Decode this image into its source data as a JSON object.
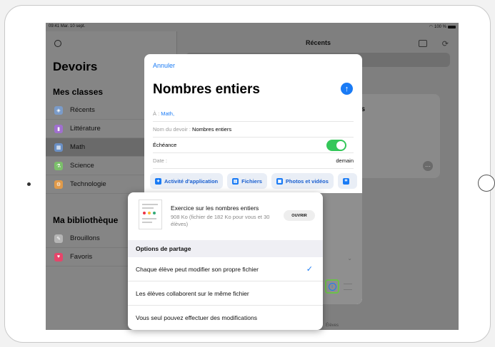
{
  "status": {
    "time": "09:41",
    "date": "Mar. 10 sept.",
    "battery": "100 %"
  },
  "sidebar": {
    "title": "Devoirs",
    "classes_header": "Mes classes",
    "classes": [
      {
        "label": "Récents",
        "color": "#7a9bc9",
        "icon": "recent-icon"
      },
      {
        "label": "Littérature",
        "color": "#a06fcf",
        "icon": "book-icon"
      },
      {
        "label": "Math",
        "color": "#6a8fc4",
        "icon": "calculator-icon"
      },
      {
        "label": "Science",
        "color": "#7bbf6a",
        "icon": "science-icon"
      },
      {
        "label": "Technologie",
        "color": "#e09a4a",
        "icon": "technology-icon"
      }
    ],
    "library_header": "Ma bibliothèque",
    "library": [
      {
        "label": "Brouillons",
        "color": "#b5b5b5",
        "icon": "draft-icon"
      },
      {
        "label": "Favoris",
        "color": "#e6456a",
        "icon": "heart-icon"
      }
    ]
  },
  "main": {
    "title": "Récents",
    "card_small": "CE",
    "card_big": "plantes",
    "card_more": "···",
    "bottom_label": "Élèves"
  },
  "sheet": {
    "cancel": "Annuler",
    "title": "Nombres entiers",
    "to_label": "À :",
    "to_value": "Math,",
    "name_label": "Nom du devoir :",
    "name_value": "Nombres entiers",
    "due_label": "Échéance",
    "date_label": "Date :",
    "date_value": "demain",
    "chips": [
      {
        "label": "Activité d'application",
        "icon": "activity-icon"
      },
      {
        "label": "Fichiers",
        "icon": "file-icon"
      },
      {
        "label": "Photos et vidéos",
        "icon": "photo-icon"
      }
    ]
  },
  "popover": {
    "file_name": "Exercice sur les nombres entiers",
    "file_meta": "908 Ko (fichier de 182 Ko pour vous et 30 élèves)",
    "open_label": "OUVRIR",
    "options_header": "Options de partage",
    "options": [
      {
        "label": "Chaque élève peut modifier son propre fichier",
        "selected": true
      },
      {
        "label": "Les élèves collaborent sur le même fichier",
        "selected": false
      },
      {
        "label": "Vous seul pouvez effectuer des modifications",
        "selected": false
      }
    ]
  },
  "colors": {
    "accent": "#1a7bf5",
    "toggle_on": "#34c759",
    "highlight": "#6cc04a"
  }
}
